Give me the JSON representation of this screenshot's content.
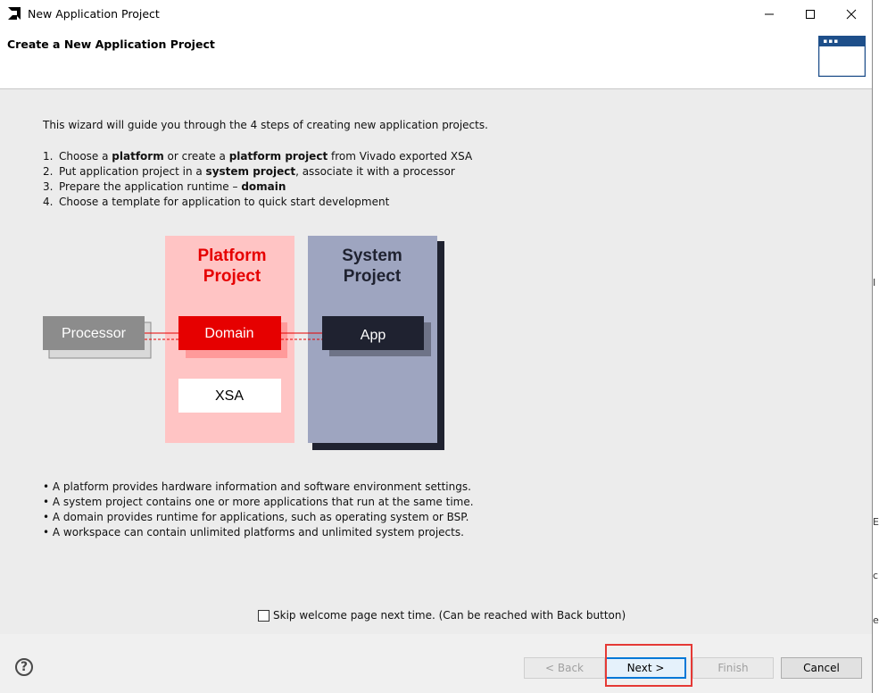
{
  "window": {
    "title": "New Application Project"
  },
  "header": {
    "title": "Create a New Application Project"
  },
  "intro": "This wizard will guide you through the 4 steps of creating new application projects.",
  "steps": [
    {
      "num": "1.",
      "parts": [
        {
          "t": "Choose a "
        },
        {
          "t": "platform",
          "b": true
        },
        {
          "t": " or create a "
        },
        {
          "t": "platform project",
          "b": true
        },
        {
          "t": " from Vivado exported XSA"
        }
      ]
    },
    {
      "num": "2.",
      "parts": [
        {
          "t": "Put application project in a "
        },
        {
          "t": "system project",
          "b": true
        },
        {
          "t": ", associate it with a processor"
        }
      ]
    },
    {
      "num": "3.",
      "parts": [
        {
          "t": "Prepare the application runtime – "
        },
        {
          "t": "domain",
          "b": true
        }
      ]
    },
    {
      "num": "4.",
      "parts": [
        {
          "t": "Choose a template for application to quick start development"
        }
      ]
    }
  ],
  "diagram": {
    "platform_title_1": "Platform",
    "platform_title_2": "Project",
    "system_title_1": "System",
    "system_title_2": "Project",
    "processor": "Processor",
    "domain": "Domain",
    "app": "App",
    "xsa": "XSA",
    "colors": {
      "platform_bg": "#ffc4c4",
      "domain": "#e60000",
      "system_bg": "#9ea5c0",
      "app": "#1f2230",
      "processor": "#8c8c8c"
    }
  },
  "bullets": [
    "A platform provides hardware information and software environment settings.",
    "A system project contains one or more applications that run at the same time.",
    "A domain provides runtime for applications, such as operating system or BSP.",
    "A workspace can contain unlimited platforms and unlimited system projects."
  ],
  "skip_label": "Skip welcome page next time. (Can be reached with Back button)",
  "buttons": {
    "back": "< Back",
    "next": "Next >",
    "finish": "Finish",
    "cancel": "Cancel"
  },
  "help": "?"
}
